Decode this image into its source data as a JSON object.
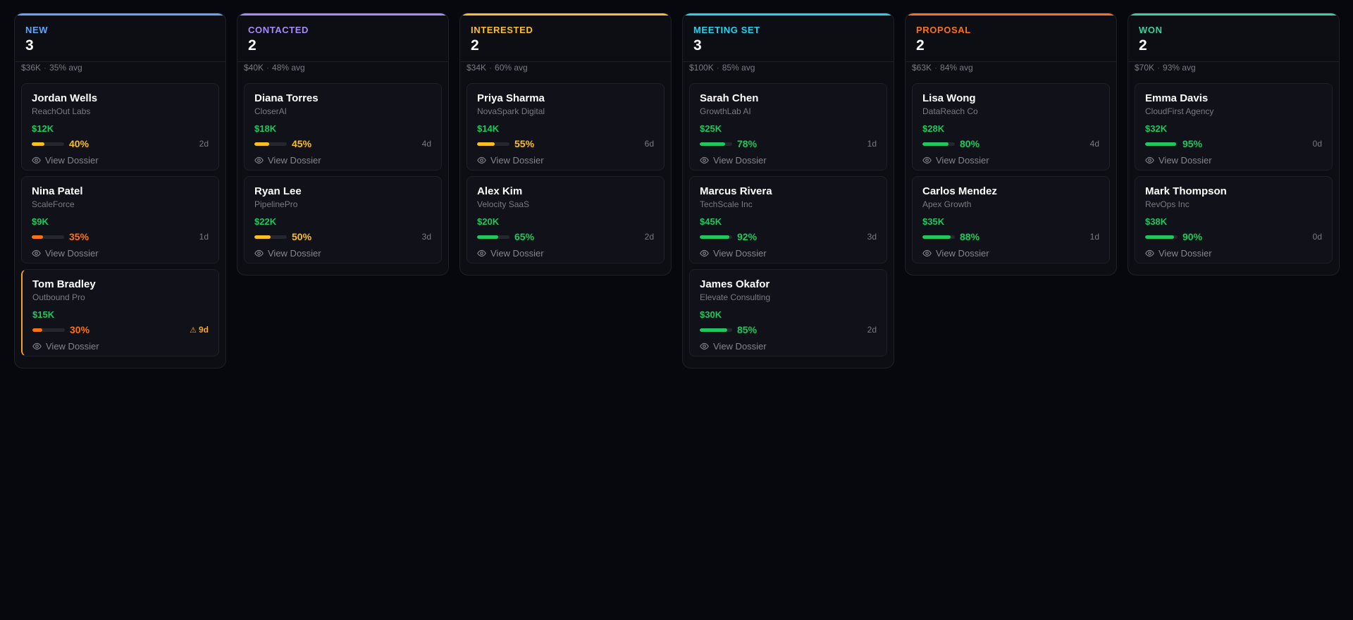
{
  "columns": [
    {
      "id": "new",
      "title": "NEW",
      "count": "3",
      "total": "$36K",
      "avg": "35% avg",
      "accent": "#60a5fa",
      "cards": [
        {
          "name": "Jordan Wells",
          "company": "ReachOut Labs",
          "value": "$12K",
          "prob": 40,
          "prob_label": "40%",
          "age": "2d",
          "warn": false
        },
        {
          "name": "Nina Patel",
          "company": "ScaleForce",
          "value": "$9K",
          "prob": 35,
          "prob_label": "35%",
          "age": "1d",
          "warn": false
        },
        {
          "name": "Tom Bradley",
          "company": "Outbound Pro",
          "value": "$15K",
          "prob": 30,
          "prob_label": "30%",
          "age": "9d",
          "warn": true
        }
      ]
    },
    {
      "id": "contacted",
      "title": "CONTACTED",
      "count": "2",
      "total": "$40K",
      "avg": "48% avg",
      "accent": "#a78bfa",
      "cards": [
        {
          "name": "Diana Torres",
          "company": "CloserAI",
          "value": "$18K",
          "prob": 45,
          "prob_label": "45%",
          "age": "4d",
          "warn": false
        },
        {
          "name": "Ryan Lee",
          "company": "PipelinePro",
          "value": "$22K",
          "prob": 50,
          "prob_label": "50%",
          "age": "3d",
          "warn": false
        }
      ]
    },
    {
      "id": "interested",
      "title": "INTERESTED",
      "count": "2",
      "total": "$34K",
      "avg": "60% avg",
      "accent": "#fbbf24",
      "cards": [
        {
          "name": "Priya Sharma",
          "company": "NovaSpark Digital",
          "value": "$14K",
          "prob": 55,
          "prob_label": "55%",
          "age": "6d",
          "warn": false
        },
        {
          "name": "Alex Kim",
          "company": "Velocity SaaS",
          "value": "$20K",
          "prob": 65,
          "prob_label": "65%",
          "age": "2d",
          "warn": false
        }
      ]
    },
    {
      "id": "meeting-set",
      "title": "MEETING SET",
      "count": "3",
      "total": "$100K",
      "avg": "85% avg",
      "accent": "#22d3ee",
      "cards": [
        {
          "name": "Sarah Chen",
          "company": "GrowthLab AI",
          "value": "$25K",
          "prob": 78,
          "prob_label": "78%",
          "age": "1d",
          "warn": false
        },
        {
          "name": "Marcus Rivera",
          "company": "TechScale Inc",
          "value": "$45K",
          "prob": 92,
          "prob_label": "92%",
          "age": "3d",
          "warn": false
        },
        {
          "name": "James Okafor",
          "company": "Elevate Consulting",
          "value": "$30K",
          "prob": 85,
          "prob_label": "85%",
          "age": "2d",
          "warn": false
        }
      ]
    },
    {
      "id": "proposal",
      "title": "PROPOSAL",
      "count": "2",
      "total": "$63K",
      "avg": "84% avg",
      "accent": "#f97316",
      "cards": [
        {
          "name": "Lisa Wong",
          "company": "DataReach Co",
          "value": "$28K",
          "prob": 80,
          "prob_label": "80%",
          "age": "4d",
          "warn": false
        },
        {
          "name": "Carlos Mendez",
          "company": "Apex Growth",
          "value": "$35K",
          "prob": 88,
          "prob_label": "88%",
          "age": "1d",
          "warn": false
        }
      ]
    },
    {
      "id": "won",
      "title": "WON",
      "count": "2",
      "total": "$70K",
      "avg": "93% avg",
      "accent": "#34d399",
      "cards": [
        {
          "name": "Emma Davis",
          "company": "CloudFirst Agency",
          "value": "$32K",
          "prob": 95,
          "prob_label": "95%",
          "age": "0d",
          "warn": false
        },
        {
          "name": "Mark Thompson",
          "company": "RevOps Inc",
          "value": "$38K",
          "prob": 90,
          "prob_label": "90%",
          "age": "0d",
          "warn": false
        }
      ]
    }
  ],
  "dossier_label": "View Dossier",
  "colors": {
    "value": "#22c55e",
    "prob_high": "#22c55e",
    "prob_mid": "#fbbf24",
    "prob_low": "#f97316",
    "warn": "#f5a524"
  },
  "icons": {
    "dossier": "eye-icon",
    "warn": "warning-triangle-icon"
  }
}
